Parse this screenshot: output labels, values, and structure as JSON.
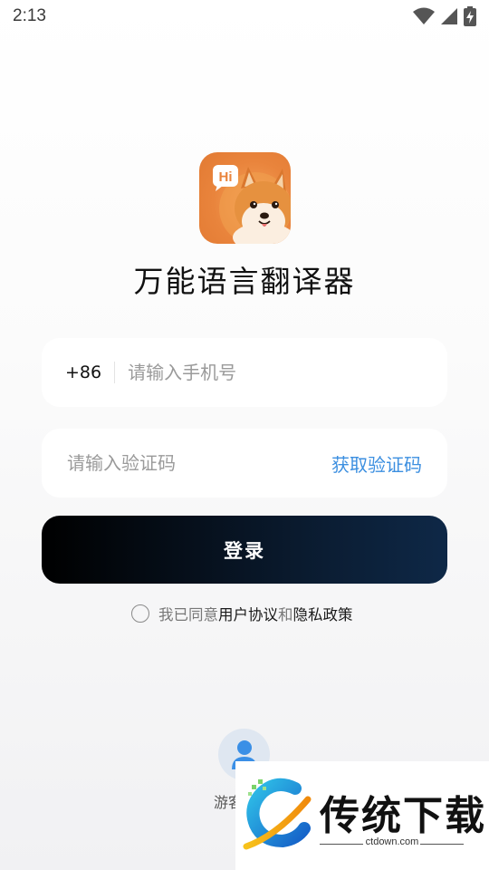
{
  "status_bar": {
    "time": "2:13",
    "icons": [
      "wifi-icon",
      "signal-icon",
      "battery-charging-icon"
    ]
  },
  "app": {
    "icon_badge": "Hi",
    "icon": "shiba-dog-app-icon",
    "title": "万能语言翻译器"
  },
  "phone_field": {
    "prefix": "+86",
    "placeholder": "请输入手机号",
    "value": ""
  },
  "code_field": {
    "placeholder": "请输入验证码",
    "value": "",
    "get_code_label": "获取验证码"
  },
  "login_button": {
    "label": "登录"
  },
  "agreement": {
    "checked": false,
    "prefix": "我已同意",
    "user_agreement": "用户协议",
    "conjunction": "和",
    "privacy_policy": "隐私政策"
  },
  "guest": {
    "label": "游客",
    "icon": "person-icon"
  },
  "watermark": {
    "title": "传统下载",
    "domain": "ctdown.com"
  },
  "colors": {
    "accent_link": "#3c8fe0",
    "button_start": "#000000",
    "button_end": "#0e2847",
    "app_icon_orange": "#e9843c"
  }
}
